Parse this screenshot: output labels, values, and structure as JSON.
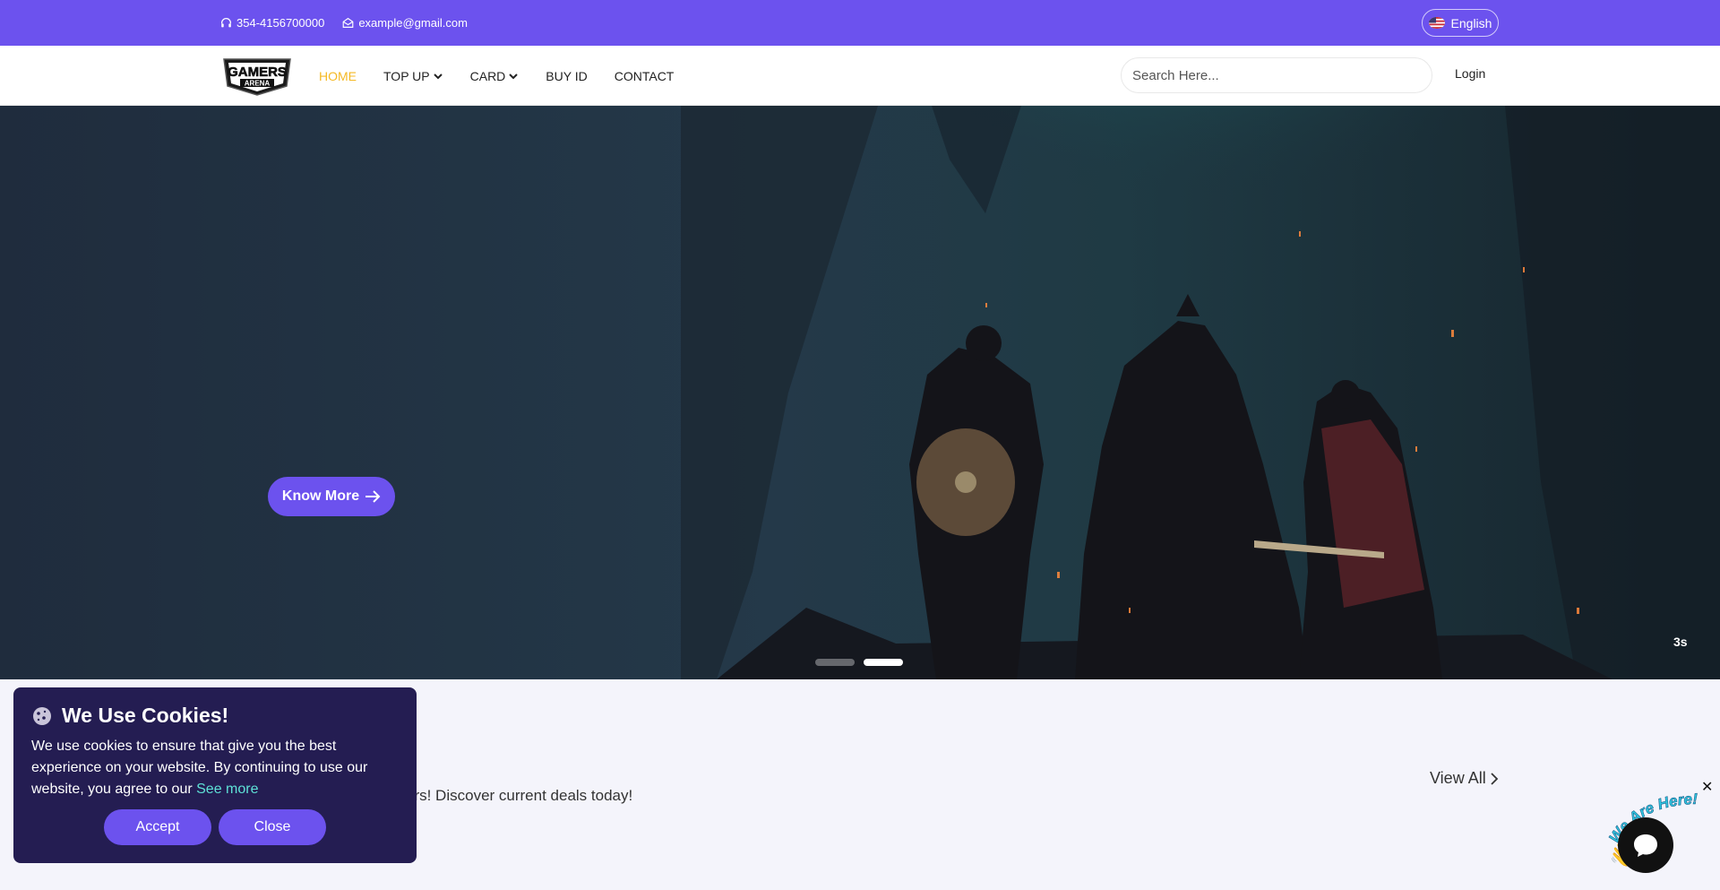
{
  "topbar": {
    "phone": "354-4156700000",
    "email": "example@gmail.com",
    "language": "English"
  },
  "nav": {
    "logo_text_top": "GAMERS",
    "logo_text_bottom": "ARENA",
    "items": [
      {
        "label": "HOME",
        "active": true,
        "dropdown": false
      },
      {
        "label": "TOP UP",
        "active": false,
        "dropdown": true
      },
      {
        "label": "CARD",
        "active": false,
        "dropdown": true
      },
      {
        "label": "BUY ID",
        "active": false,
        "dropdown": false
      },
      {
        "label": "CONTACT",
        "active": false,
        "dropdown": false
      }
    ],
    "search_placeholder": "Search Here...",
    "login": "Login"
  },
  "hero": {
    "cta": "Know More",
    "slide_count": 2,
    "active_slide": 2,
    "timer": "3s"
  },
  "section": {
    "subtitle_visible": "ers! Discover current deals today!",
    "view_all": "View All"
  },
  "cookie": {
    "title": "We Use Cookies!",
    "body": "We use cookies to ensure that give you the best experience on your website. By continuing to use our website, you agree to our",
    "see_more": "See more",
    "accept": "Accept",
    "close": "Close"
  },
  "chat": {
    "close": "✕",
    "badge": "We Are Here!"
  },
  "colors": {
    "primary": "#6c52ee",
    "active_nav": "#f5b925",
    "cookie_bg": "#241d52",
    "link_accent": "#5ee0d6"
  }
}
